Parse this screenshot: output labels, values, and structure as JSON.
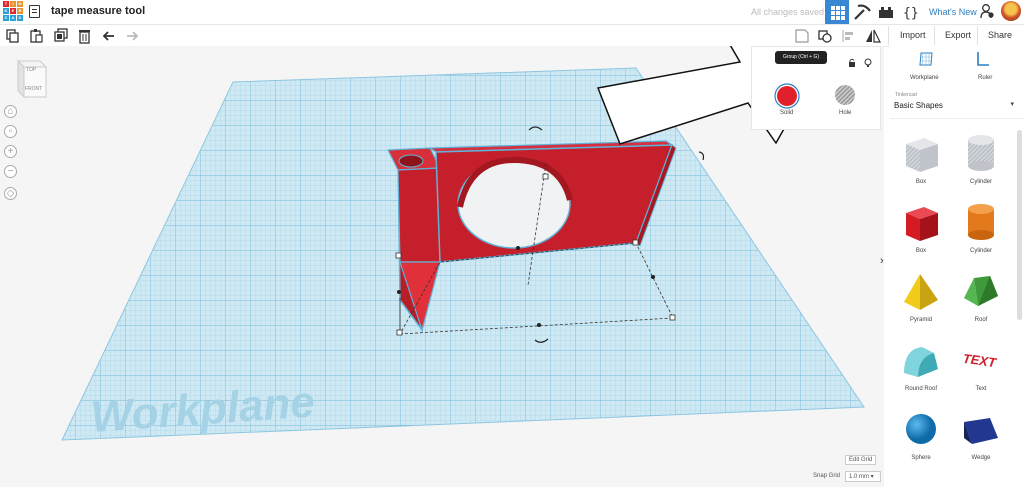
{
  "header": {
    "project_title": "tape measure tool",
    "save_status": "All changes saved",
    "whats_new": "What's New",
    "logo_letters": [
      "T",
      "I",
      "N",
      "K",
      "E",
      "R",
      "C",
      "A",
      "D"
    ]
  },
  "toolbar": {
    "import_label": "Import",
    "export_label": "Export",
    "share_label": "Share",
    "tooltip": "Group (Ctrl + G)"
  },
  "viewcube": {
    "top_label": "TOP",
    "front_label": "FRONT"
  },
  "inspector": {
    "solid_label": "Solid",
    "hole_label": "Hole",
    "solid_color": "#e0202a"
  },
  "workplane_text": "Workplane",
  "sidebar": {
    "workplane_label": "Workplane",
    "ruler_label": "Ruler",
    "library_source": "Tinkercad",
    "library_name": "Basic Shapes",
    "shapes": [
      {
        "label": "Box",
        "color": "#c8ccd3"
      },
      {
        "label": "Cylinder",
        "color": "#c8ccd3"
      },
      {
        "label": "Box",
        "color": "#d41b24"
      },
      {
        "label": "Cylinder",
        "color": "#e27a1d"
      },
      {
        "label": "Pyramid",
        "color": "#f1cb1b"
      },
      {
        "label": "Roof",
        "color": "#3e9a3b"
      },
      {
        "label": "Round Roof",
        "color": "#55c3cf"
      },
      {
        "label": "Text",
        "color": "#d11f2a"
      },
      {
        "label": "Sphere",
        "color": "#1b8bd0"
      },
      {
        "label": "Wedge",
        "color": "#22378f"
      }
    ]
  },
  "footer": {
    "edit_grid": "Edit Grid",
    "snap_grid_label": "Snap Grid",
    "snap_grid_value": "1.0 mm"
  }
}
